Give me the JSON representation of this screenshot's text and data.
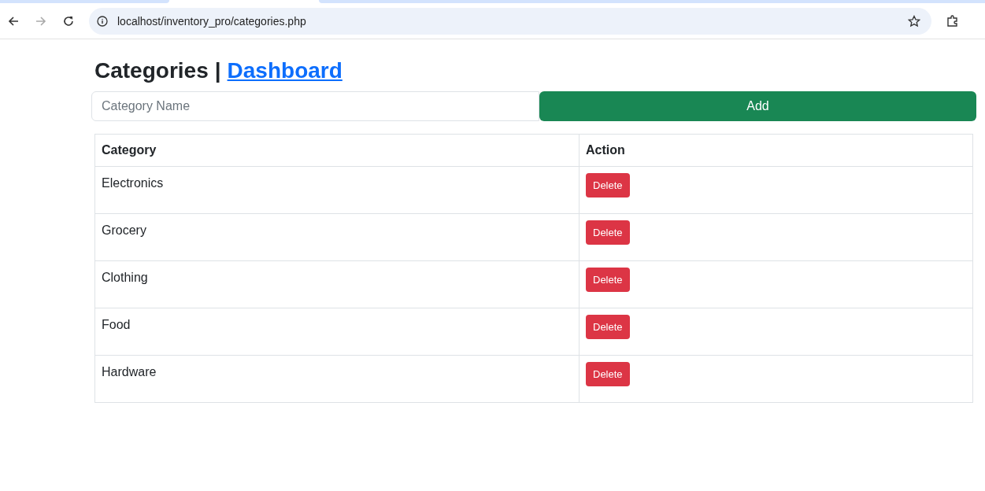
{
  "browser": {
    "url": "localhost/inventory_pro/categories.php",
    "forward_disabled": true
  },
  "heading": {
    "title": "Categories",
    "separator": "|",
    "link": "Dashboard"
  },
  "form": {
    "placeholder": "Category Name",
    "button": "Add"
  },
  "table": {
    "columns": [
      "Category",
      "Action"
    ],
    "rows": [
      {
        "category": "Electronics",
        "action": "Delete"
      },
      {
        "category": "Grocery",
        "action": "Delete"
      },
      {
        "category": "Clothing",
        "action": "Delete"
      },
      {
        "category": "Food",
        "action": "Delete"
      },
      {
        "category": "Hardware",
        "action": "Delete"
      }
    ]
  }
}
